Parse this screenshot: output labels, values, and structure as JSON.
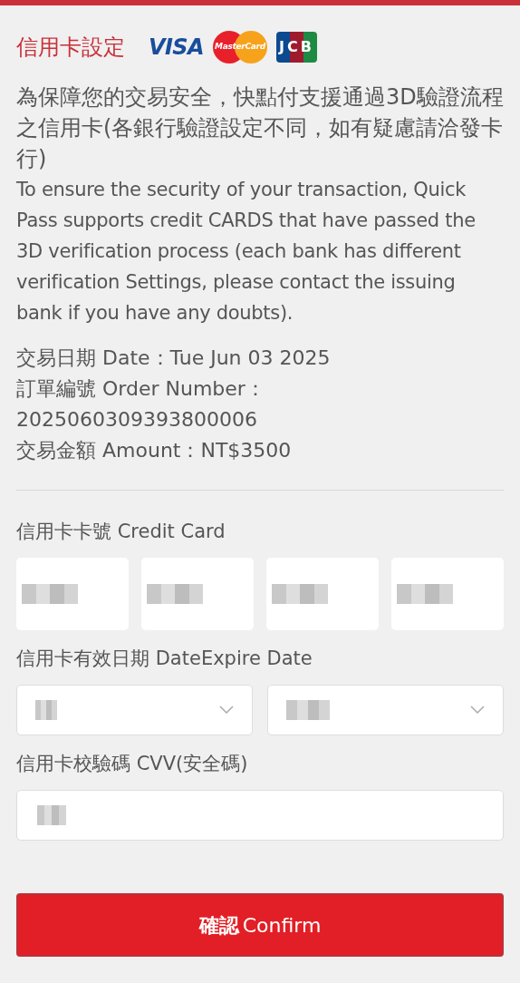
{
  "header": {
    "title": "信用卡設定",
    "logos": [
      {
        "kind": "visa",
        "text": "VISA"
      },
      {
        "kind": "mastercard",
        "text": "MasterCard"
      },
      {
        "kind": "jcb",
        "text": "JCB"
      }
    ]
  },
  "notice_zh": "為保障您的交易安全，快點付支援通過3D驗證流程之信用卡(各銀行驗證設定不同，如有疑慮請洽發卡行)",
  "notice_en": "To ensure the security of your transaction, Quick Pass supports credit CARDS that have passed the 3D verification process (each bank has different verification Settings, please contact the issuing bank if you have any doubts).",
  "order_info": [
    {
      "label_zh": "交易日期",
      "label_en": "Date：",
      "value": "Tue Jun 03 2025"
    },
    {
      "label_zh": "訂單編號",
      "label_en": "Order Number：",
      "value": "2025060309393800006"
    },
    {
      "label_zh": "交易金額",
      "label_en": "Amount：",
      "value": "NT$3500"
    }
  ],
  "card_number": {
    "label_zh": "信用卡卡號",
    "label_en": "Credit Card",
    "fields": [
      {
        "masked": true
      },
      {
        "masked": true
      },
      {
        "masked": true
      },
      {
        "masked": true
      }
    ]
  },
  "expiry": {
    "label_zh": "信用卡有效日期",
    "label_en": "DateExpire Date",
    "selects": [
      {
        "masked": true
      },
      {
        "masked": true
      }
    ]
  },
  "cvv": {
    "label_zh": "信用卡校驗碼",
    "label_en": "CVV(安全碼)",
    "masked": true
  },
  "confirm_button": {
    "label_zh": "確認",
    "label_en": "Confirm"
  }
}
